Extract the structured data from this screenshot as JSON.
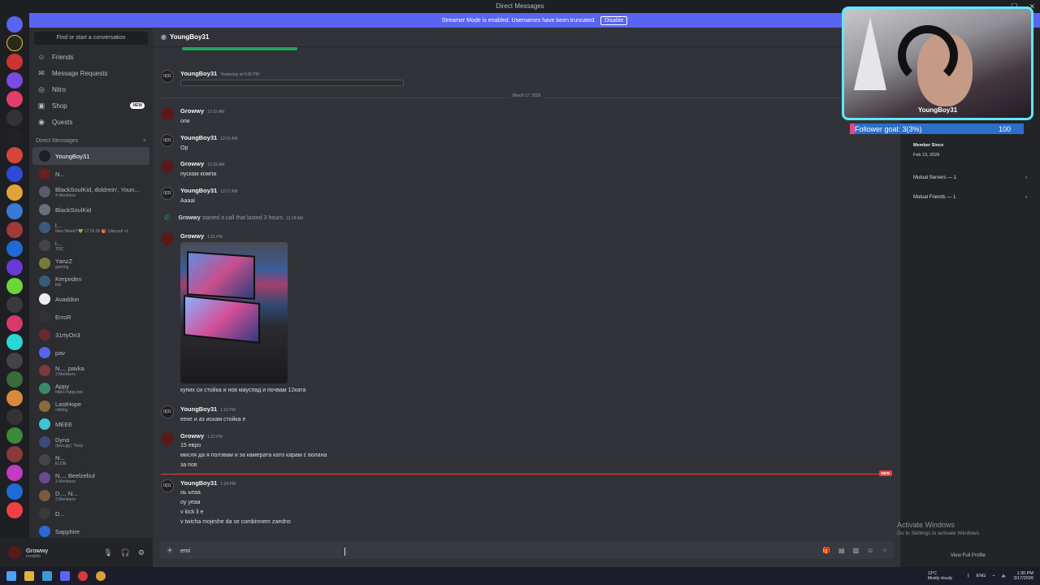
{
  "window": {
    "title": "Direct Messages",
    "controls": [
      "—",
      "☐",
      "✕"
    ]
  },
  "banner": {
    "text": "Streamer Mode is enabled. Usernames have been truncated.",
    "disable": "Disable"
  },
  "sidebar": {
    "search_placeholder": "Find or start a conversation",
    "nav": [
      {
        "label": "Friends",
        "icon": "friends-icon"
      },
      {
        "label": "Message Requests",
        "icon": "mail-icon"
      },
      {
        "label": "Nitro",
        "icon": "nitro-icon"
      },
      {
        "label": "Shop",
        "icon": "shop-icon",
        "badge": "NEW"
      },
      {
        "label": "Quests",
        "icon": "quests-icon"
      }
    ],
    "dm_header": "Direct Messages",
    "dms": [
      {
        "name": "YoungBoy31",
        "sub": "",
        "color": "#1e1f22",
        "active": true
      },
      {
        "name": "N...",
        "sub": "",
        "color": "#6b1f1f"
      },
      {
        "name": "BlackSoulKid, doldrein', Youn...",
        "sub": "4 Members",
        "color": "#5a5a6a"
      },
      {
        "name": "BlackSoulKid",
        "sub": "",
        "color": "#6b6f7a"
      },
      {
        "name": "l...",
        "sub": "New Week!! 💚 17.03.26 🎁 1discord +1",
        "color": "#3c5a7a"
      },
      {
        "name": "i...",
        "sub": "",
        "badge": "TDC",
        "color": "#444"
      },
      {
        "name": "YanzZ",
        "sub": "gaming",
        "color": "#7a7a3a"
      },
      {
        "name": "Kerpeden",
        "sub": "brb",
        "color": "#3a5a7a"
      },
      {
        "name": "Avaddon",
        "sub": "",
        "color": "#eeeeee"
      },
      {
        "name": "ErroR",
        "sub": "",
        "color": "#333"
      },
      {
        "name": "31rtyOn3",
        "sub": "",
        "color": "#6a2a2a"
      },
      {
        "name": "pav",
        "sub": "",
        "color": "#5865f2"
      },
      {
        "name": "N..., pavka",
        "sub": "3 Members",
        "color": "#7a3a3a"
      },
      {
        "name": "Appy",
        "sub": "https://appy.bot",
        "color": "#3a8a6a"
      },
      {
        "name": "LastHope",
        "sub": "chilling",
        "color": "#8a6a3a"
      },
      {
        "name": "MEE6",
        "sub": "",
        "color": "#3ec5d6"
      },
      {
        "name": "Dyno",
        "sub": "dyno.gg | ?help",
        "color": "#3a4a7a"
      },
      {
        "name": "N...",
        "sub": "",
        "badge": "ELDN",
        "color": "#444"
      },
      {
        "name": "N..., Beelzebul",
        "sub": "3 Members",
        "color": "#6a4a8a"
      },
      {
        "name": "D..., N...",
        "sub": "3 Members",
        "color": "#7a5a3a"
      },
      {
        "name": "D...",
        "sub": "",
        "color": "#3a3a3a"
      },
      {
        "name": "Sapphire",
        "sub": "",
        "color": "#2a6ad6"
      }
    ]
  },
  "user": {
    "name": "Growwy",
    "status": "Invisible"
  },
  "chat": {
    "header": "YoungBoy31",
    "date_divider": "March 17, 2026",
    "new_label": "NEW",
    "messages": [
      {
        "author": "YoungBoy31",
        "time": "Yesterday at 9:05 PM",
        "lines": [],
        "embed": true
      },
      {
        "author": "Growwy",
        "time": "12:15 AM",
        "lines": [
          "опи"
        ]
      },
      {
        "author": "YoungBoy31",
        "time": "12:15 AM",
        "lines": [
          "Op"
        ]
      },
      {
        "author": "Growwy",
        "time": "12:16 AM",
        "lines": [
          "пускам компа"
        ]
      },
      {
        "author": "YoungBoy31",
        "time": "12:17 AM",
        "lines": [
          "Aaaai"
        ]
      },
      {
        "author": "Growwy",
        "time": "1:21 PM",
        "lines": [
          "купих си стойка и нов мауспад и почвам 12ката"
        ],
        "image": true
      },
      {
        "author": "YoungBoy31",
        "time": "1:22 PM",
        "lines": [
          "еехе и аз искам стойка е"
        ]
      },
      {
        "author": "Growwy",
        "time": "1:22 PM",
        "lines": [
          "15 евро",
          "мисля да я ползвам и за камерата като карам с волана",
          "за пов"
        ]
      },
      {
        "author": "YoungBoy31",
        "time": "1:24 PM",
        "lines": [
          "оь ьеаа",
          "oy yeaa",
          "v kick li e",
          "v twicha mojeshe da se combinnem zaedno"
        ]
      }
    ],
    "call": {
      "caller": "Growwy",
      "text": "started a call that lasted 3 hours.",
      "time": "12:18 AM"
    },
    "input_value": "emi"
  },
  "stream": {
    "name": "YoungBoy31",
    "follower_goal": "Follower goal:",
    "current": "3(3%)",
    "goal": "100",
    "progress": 0.03
  },
  "profile": {
    "member_since_label": "Member Since",
    "member_since": "Feb 13, 2026",
    "mutual_servers": "Mutual Servers — 1",
    "mutual_friends": "Mutual Friends — 1",
    "view_full": "View Full Profile"
  },
  "watermark": {
    "title": "Activate Windows",
    "sub": "Go to Settings to activate Windows."
  },
  "taskbar": {
    "weather_temp": "13°C",
    "weather_desc": "Mostly cloudy",
    "lang": "ENG",
    "time": "1:30 PM",
    "date": "3/17/2026"
  }
}
